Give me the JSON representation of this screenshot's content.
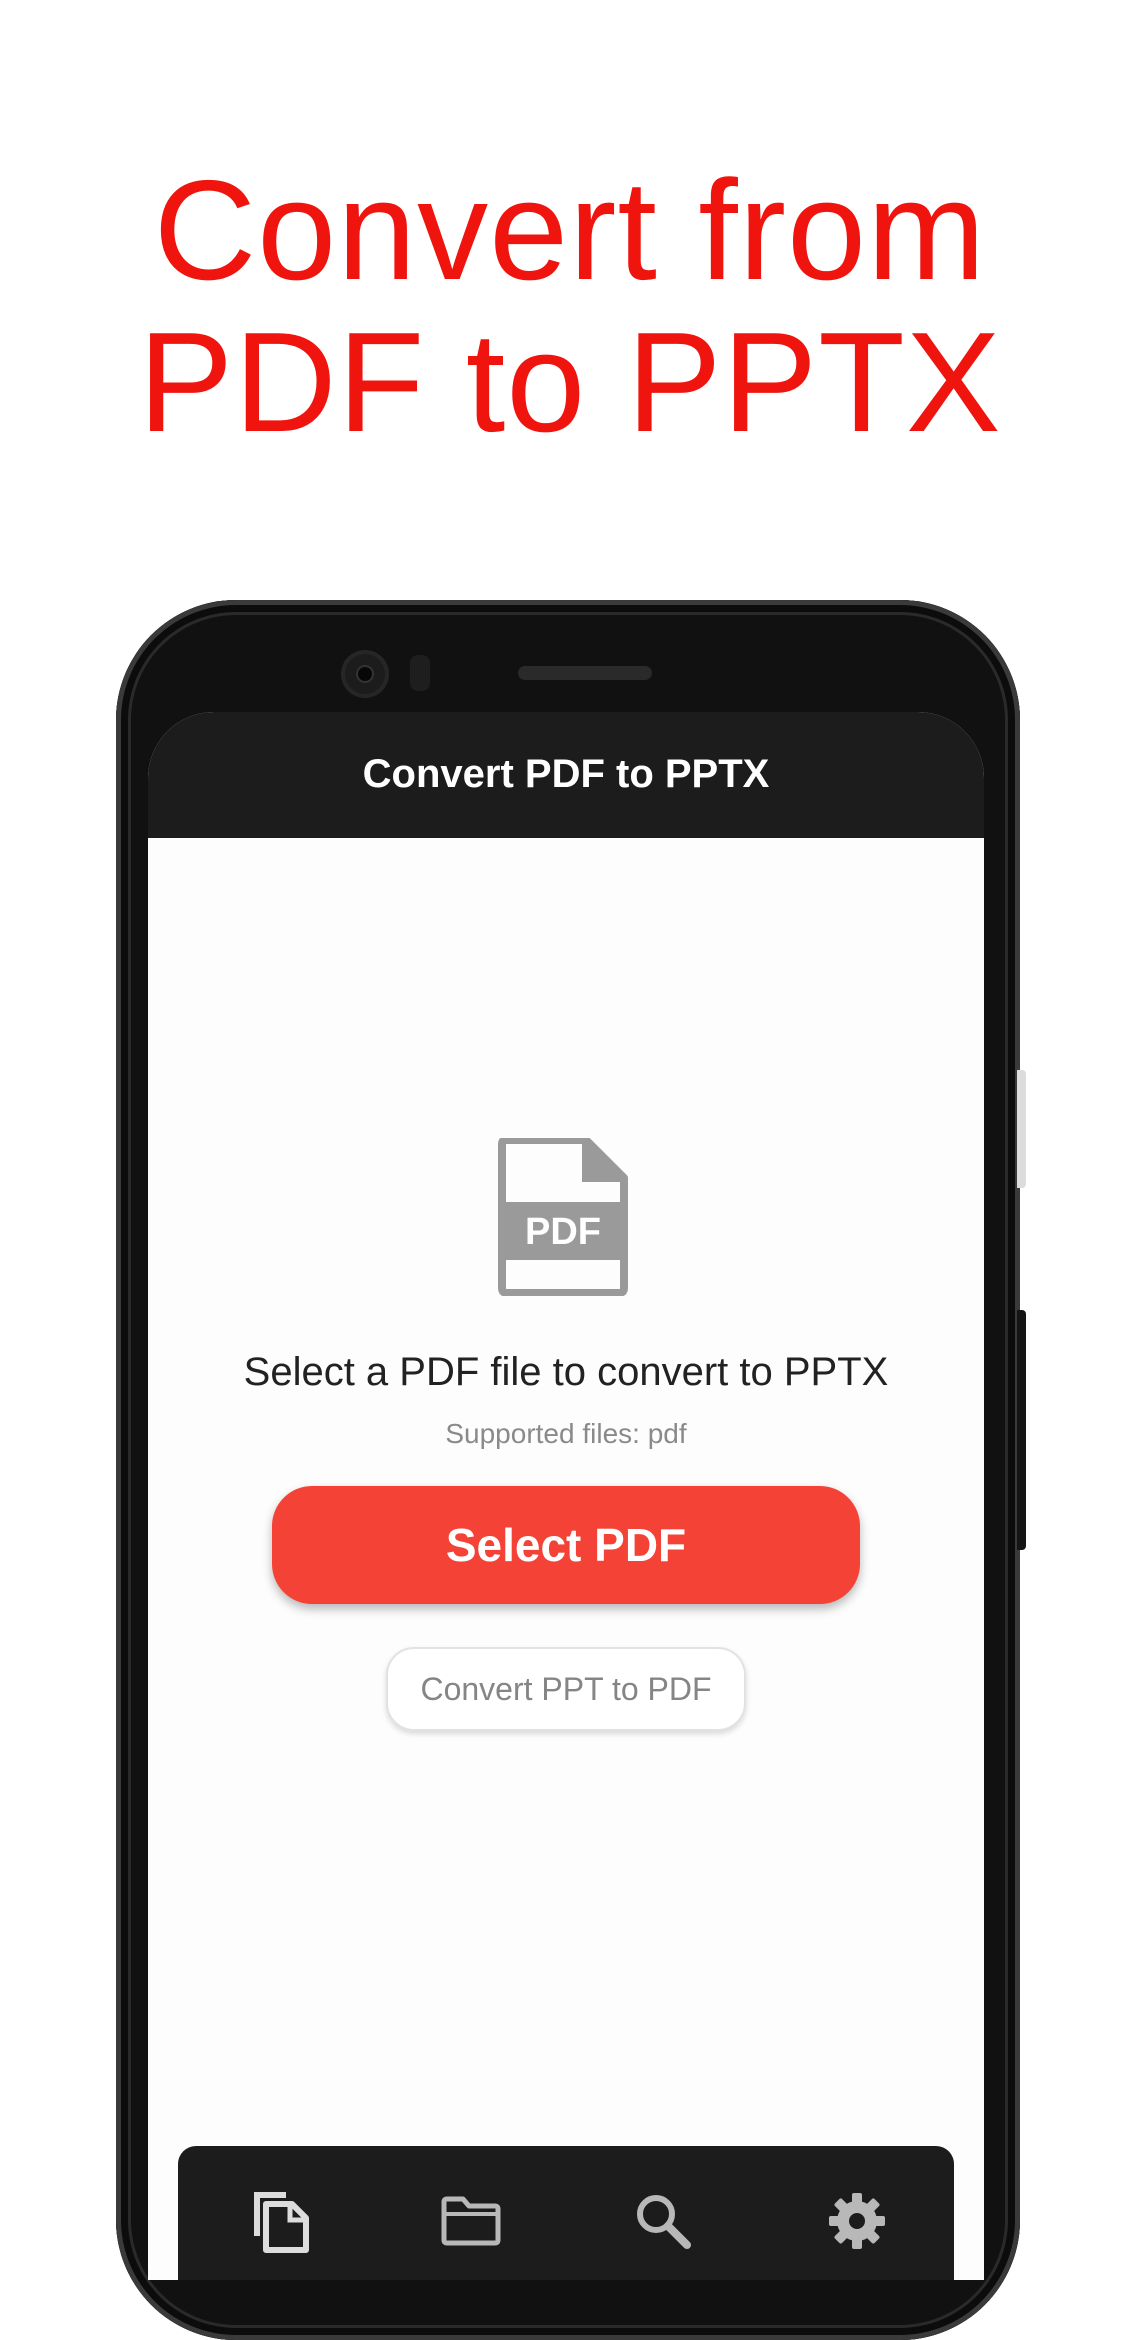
{
  "headline": {
    "line1": "Convert from",
    "line2": "PDF to PPTX",
    "color": "#f0140f"
  },
  "app": {
    "title": "Convert PDF to PPTX",
    "file_icon_label": "PDF",
    "prompt": "Select a PDF file to convert to PPTX",
    "supported": "Supported files: pdf",
    "select_button": "Select PDF",
    "secondary_button": "Convert PPT to PDF",
    "accent_color": "#f44336",
    "appbar_color": "#1c1c1c"
  },
  "bottom_nav": {
    "items": [
      {
        "icon": "copy-files-icon",
        "active": true
      },
      {
        "icon": "folder-icon",
        "active": false
      },
      {
        "icon": "search-icon",
        "active": false
      },
      {
        "icon": "gear-icon",
        "active": false
      }
    ]
  }
}
